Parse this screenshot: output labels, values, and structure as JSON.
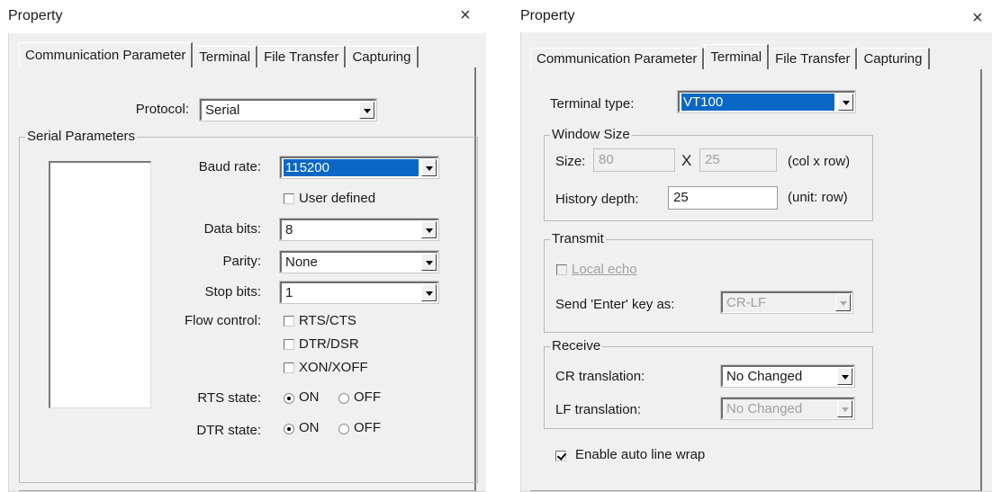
{
  "left": {
    "title": "Property",
    "close_glyph": "×",
    "tabs": [
      "Communication Parameter",
      "Terminal",
      "File Transfer",
      "Capturing"
    ],
    "active_tab": "Communication Parameter",
    "protocol_label": "Protocol:",
    "protocol_value": "Serial",
    "group_label": "Serial Parameters",
    "baud_label": "Baud rate:",
    "baud_value": "115200",
    "user_defined_label": "User defined",
    "user_defined_checked": false,
    "data_bits_label": "Data bits:",
    "data_bits_value": "8",
    "parity_label": "Parity:",
    "parity_value": "None",
    "stop_bits_label": "Stop bits:",
    "stop_bits_value": "1",
    "flow_label": "Flow control:",
    "flow_options": [
      {
        "label": "RTS/CTS",
        "checked": false
      },
      {
        "label": "DTR/DSR",
        "checked": false
      },
      {
        "label": "XON/XOFF",
        "checked": false
      }
    ],
    "rts_label": "RTS state:",
    "dtr_label": "DTR state:",
    "on_label": "ON",
    "off_label": "OFF",
    "rts_state": "ON",
    "dtr_state": "ON"
  },
  "right": {
    "title": "Property",
    "close_glyph": "×",
    "tabs": [
      "Communication Parameter",
      "Terminal",
      "File Transfer",
      "Capturing"
    ],
    "active_tab": "Terminal",
    "terminal_type_label": "Terminal type:",
    "terminal_type_value": "VT100",
    "window_size_group": "Window Size",
    "size_label": "Size:",
    "cols_value": "80",
    "x_label": "X",
    "rows_value": "25",
    "size_unit": "(col x row)",
    "history_label": "History depth:",
    "history_value": "25",
    "history_unit": "(unit: row)",
    "transmit_group": "Transmit",
    "local_echo_label": "Local echo",
    "local_echo_checked": false,
    "send_enter_label": "Send 'Enter' key  as:",
    "send_enter_value": "CR-LF",
    "receive_group": "Receive",
    "cr_label": "CR translation:",
    "cr_value": "No Changed",
    "lf_label": "LF translation:",
    "lf_value": "No Changed",
    "wrap_label": "Enable auto line wrap",
    "wrap_checked": true
  },
  "colors": {
    "selection": "#0a67c6",
    "panel": "#f0f0f0",
    "disabled_text": "#a0a0a0"
  }
}
